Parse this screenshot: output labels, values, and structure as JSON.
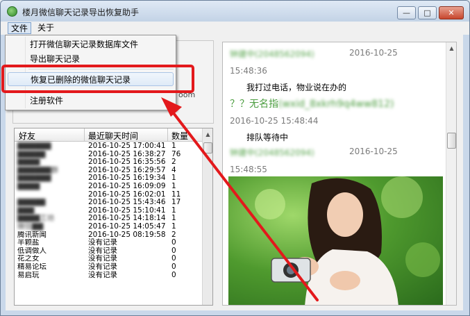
{
  "window": {
    "title": "楼月微信聊天记录导出恢复助手",
    "minimize_glyph": "—",
    "maximize_glyph": "□",
    "close_glyph": "✕"
  },
  "menubar": {
    "file": "文件",
    "about": "关于"
  },
  "file_menu": {
    "items": [
      "打开微信聊天记录数据库文件",
      "导出聊天记录",
      "恢复已删除的微信聊天记录",
      "注册软件"
    ]
  },
  "left_panel": {
    "partial_text": "oom"
  },
  "friend_list": {
    "headers": [
      "好友",
      "最近聊天时间",
      "数量"
    ],
    "rows": [
      {
        "name": "██████",
        "time": "2016-10-25 17:00:41",
        "count": "1",
        "blurred": true
      },
      {
        "name": "█████",
        "time": "2016-10-25 16:38:27",
        "count": "76",
        "blurred": true
      },
      {
        "name": "████",
        "time": "2016-10-25 16:35:56",
        "count": "2",
        "blurred": true
      },
      {
        "name": "██████群",
        "time": "2016-10-25 16:29:57",
        "count": "4",
        "blurred": true
      },
      {
        "name": "██████",
        "time": "2016-10-25 16:19:34",
        "count": "1",
        "blurred": true
      },
      {
        "name": "████",
        "time": "2016-10-25 16:09:09",
        "count": "1",
        "blurred": true
      },
      {
        "name": "",
        "time": "2016-10-25 16:02:01",
        "count": "11",
        "blurred": true
      },
      {
        "name": "█████",
        "time": "2016-10-25 15:43:46",
        "count": "17",
        "blurred": true
      },
      {
        "name": "███",
        "time": "2016-10-25 15:10:41",
        "count": "1",
        "blurred": true
      },
      {
        "name": "████工坊",
        "time": "2016-10-25 14:18:14",
        "count": "1",
        "blurred": true
      },
      {
        "name": "微信██",
        "time": "2016-10-25 14:05:47",
        "count": "1",
        "blurred": true
      },
      {
        "name": "腾讯新闻",
        "time": "2016-10-25 08:19:58",
        "count": "2",
        "blurred": false
      },
      {
        "name": "半颗盐",
        "time": "没有记录",
        "count": "0",
        "blurred": false
      },
      {
        "name": "低调做人",
        "time": "没有记录",
        "count": "0",
        "blurred": false
      },
      {
        "name": "花之女",
        "time": "没有记录",
        "count": "0",
        "blurred": false
      },
      {
        "name": "精易论坛",
        "time": "没有记录",
        "count": "0",
        "blurred": false
      },
      {
        "name": "易启玩",
        "time": "没有记录",
        "count": "0",
        "blurred": false
      }
    ]
  },
  "chat": {
    "messages": [
      {
        "sender": "钟建中(2048562094)",
        "time": "2016-10-25",
        "time2": "15:48:36",
        "text": "我打过电话，物业说在办的"
      },
      {
        "sender": "？？无名指(wxid_8xkrh9q4ww812)",
        "time": "2016-10-25 15:48:44",
        "text": "排队等待中"
      },
      {
        "sender": "钟建中(2048562094)",
        "time": "2016-10-25",
        "time2": "15:48:55"
      }
    ],
    "photo_icon": "photo-of-woman-with-camera"
  },
  "colors": {
    "annotation_red": "#e3191c",
    "sender_green": "#5aa64f",
    "timestamp_gray": "#7b7b7b"
  }
}
